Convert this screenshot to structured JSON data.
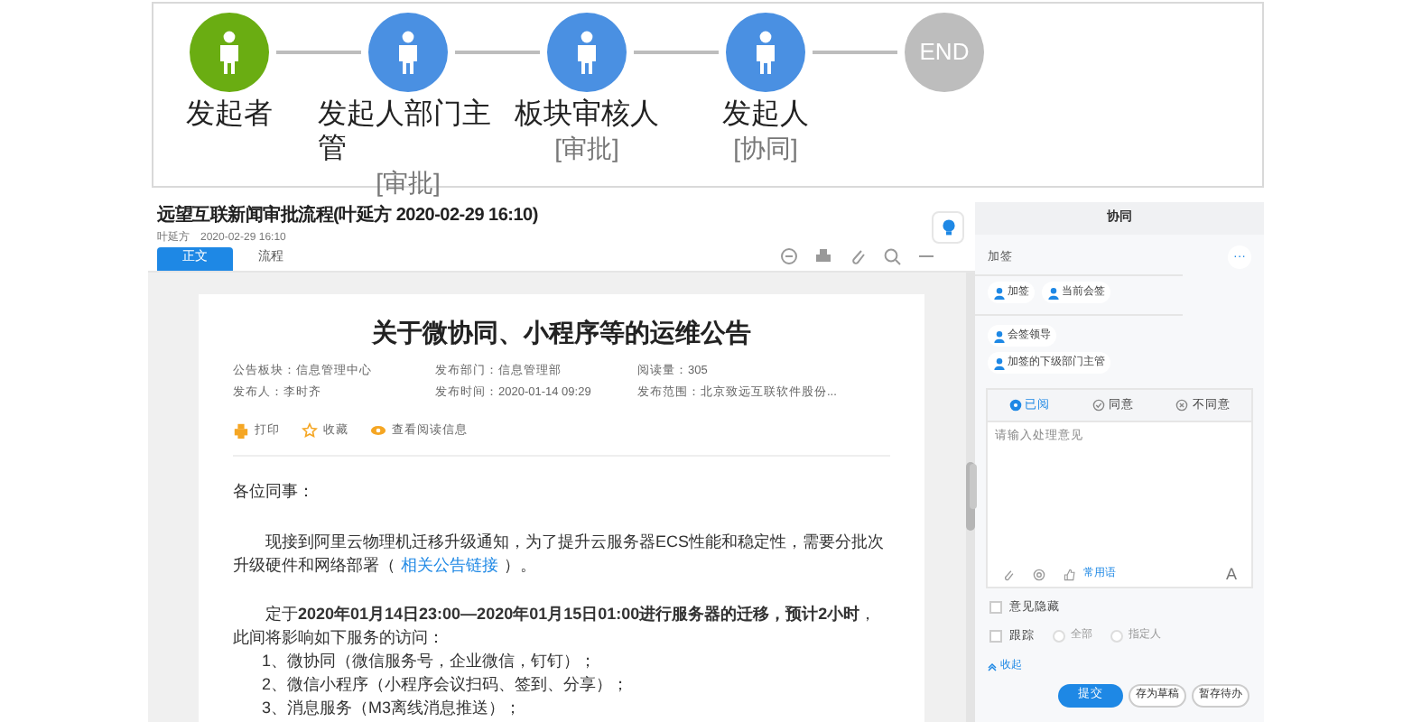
{
  "flow": {
    "steps": [
      {
        "kind": "person",
        "label": "发起者",
        "color": "#6aad12"
      },
      {
        "kind": "person",
        "label": "发起人部门主管",
        "note": "[审批]",
        "color": "#4a90e2"
      },
      {
        "kind": "person",
        "label": "板块审核人",
        "note": "[审批]",
        "color": "#4a90e2"
      },
      {
        "kind": "person",
        "label": "发起人",
        "note": "[协同]",
        "color": "#4a90e2"
      },
      {
        "kind": "end",
        "text": "END",
        "color": "#bdbdbd"
      }
    ]
  },
  "header": {
    "title": "远望互联新闻审批流程(叶延方 2020-02-29 16:10)",
    "author": "叶延方",
    "time": "2020-02-29 16:10"
  },
  "tabs": [
    {
      "label": "正文",
      "selected": true
    },
    {
      "label": "流程",
      "selected": false
    }
  ],
  "document": {
    "title": "关于微协同、小程序等的运维公告",
    "meta": [
      "公告板块：信息管理中心",
      "发布部门：信息管理部",
      "阅读量：305",
      "发布人：李时齐",
      "发布时间：2020-01-14 09:29",
      "发布范围：北京致远互联软件股份..."
    ],
    "actions": [
      {
        "kind": "print",
        "label": "打印"
      },
      {
        "kind": "star",
        "label": "收藏"
      },
      {
        "kind": "eye",
        "label": "查看阅读信息"
      }
    ],
    "greeting": "各位同事：",
    "paragraph_1": {
      "before": "现接到阿里云物理机迁移升级通知，为了提升云服务器ECS性能和稳定性，需要分批次升级硬件和网络部署（",
      "link": "相关公告链接",
      "after": "）。"
    },
    "paragraph_2": "定于**2020年01月14日23:00—2020年01月15日01:00进行服务器的迁移，预计2小时**，此间将影响如下服务的访问：",
    "list": [
      "1、微协同（微信服务号，企业微信，钉钉）；",
      "2、微信小程序（小程序会议扫码、签到、分享）；",
      "3、消息服务（M3离线消息推送）；"
    ]
  },
  "panel": {
    "title": "协同",
    "section": "加签",
    "more": "···",
    "chip_rows": [
      [
        "加签",
        "当前会签"
      ],
      [
        "会签领导"
      ],
      [
        "加签的下级部门主管"
      ]
    ],
    "opinions": [
      {
        "kind": "read",
        "label": "已阅",
        "selected": true
      },
      {
        "kind": "agree",
        "label": "同意",
        "selected": false
      },
      {
        "kind": "disagree",
        "label": "不同意",
        "selected": false
      }
    ],
    "placeholder": "请输入处理意见",
    "phrases": "常用语",
    "font_button": "A",
    "checks": [
      {
        "label": "意见隐藏",
        "checked": false
      },
      {
        "label": "跟踪",
        "checked": false
      }
    ],
    "track_options": [
      {
        "label": "全部",
        "selected": false
      },
      {
        "label": "指定人",
        "selected": false
      }
    ],
    "collapse": "收起",
    "buttons": [
      {
        "label": "提交",
        "primary": true
      },
      {
        "label": "存为草稿",
        "primary": false
      },
      {
        "label": "暂存待办",
        "primary": false
      }
    ]
  }
}
